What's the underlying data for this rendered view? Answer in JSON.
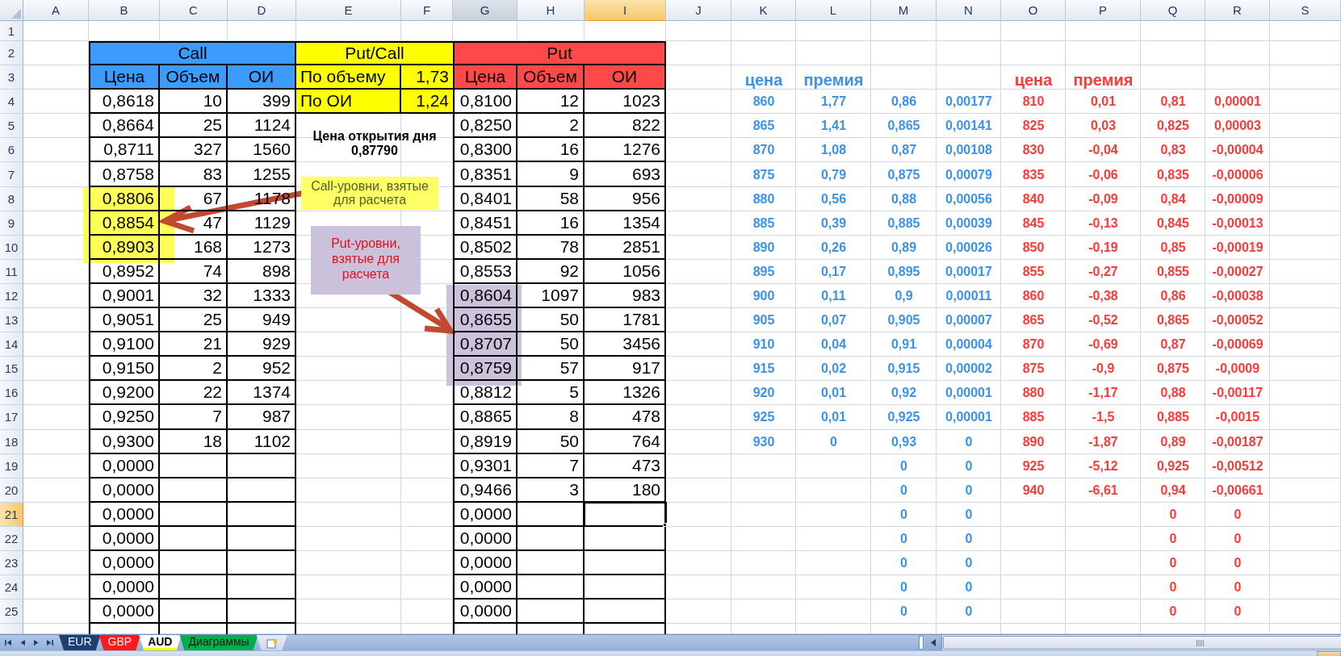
{
  "columns": [
    {
      "label": "A",
      "selected": false,
      "hovered": false
    },
    {
      "label": "B",
      "selected": false,
      "hovered": false
    },
    {
      "label": "C",
      "selected": false,
      "hovered": false
    },
    {
      "label": "D",
      "selected": false,
      "hovered": false
    },
    {
      "label": "E",
      "selected": false,
      "hovered": false
    },
    {
      "label": "F",
      "selected": false,
      "hovered": false
    },
    {
      "label": "G",
      "selected": false,
      "hovered": true
    },
    {
      "label": "H",
      "selected": false,
      "hovered": false
    },
    {
      "label": "I",
      "selected": true,
      "hovered": false
    },
    {
      "label": "J",
      "selected": false,
      "hovered": false
    },
    {
      "label": "K",
      "selected": false,
      "hovered": false
    },
    {
      "label": "L",
      "selected": false,
      "hovered": false
    },
    {
      "label": "M",
      "selected": false,
      "hovered": false
    },
    {
      "label": "N",
      "selected": false,
      "hovered": false
    },
    {
      "label": "O",
      "selected": false,
      "hovered": false
    },
    {
      "label": "P",
      "selected": false,
      "hovered": false
    },
    {
      "label": "Q",
      "selected": false,
      "hovered": false
    },
    {
      "label": "R",
      "selected": false,
      "hovered": false
    },
    {
      "label": "S",
      "selected": false,
      "hovered": false
    }
  ],
  "rows": [
    {
      "label": "1",
      "selected": false
    },
    {
      "label": "2",
      "selected": false
    },
    {
      "label": "3",
      "selected": false
    },
    {
      "label": "4",
      "selected": false
    },
    {
      "label": "5",
      "selected": false
    },
    {
      "label": "6",
      "selected": false
    },
    {
      "label": "7",
      "selected": false
    },
    {
      "label": "8",
      "selected": false
    },
    {
      "label": "9",
      "selected": false
    },
    {
      "label": "10",
      "selected": false
    },
    {
      "label": "11",
      "selected": false
    },
    {
      "label": "12",
      "selected": false
    },
    {
      "label": "13",
      "selected": false
    },
    {
      "label": "14",
      "selected": false
    },
    {
      "label": "15",
      "selected": false
    },
    {
      "label": "16",
      "selected": false
    },
    {
      "label": "17",
      "selected": false
    },
    {
      "label": "18",
      "selected": false
    },
    {
      "label": "19",
      "selected": false
    },
    {
      "label": "20",
      "selected": false
    },
    {
      "label": "21",
      "selected": true
    },
    {
      "label": "22",
      "selected": false
    },
    {
      "label": "23",
      "selected": false
    },
    {
      "label": "24",
      "selected": false
    },
    {
      "label": "25",
      "selected": false
    }
  ],
  "call_table": {
    "title": "Call",
    "headers": [
      "Цена",
      "Объем",
      "ОИ"
    ],
    "rows": [
      {
        "price": "0,8618",
        "volume": "10",
        "oi": "399",
        "highlighted": false
      },
      {
        "price": "0,8664",
        "volume": "25",
        "oi": "1124",
        "highlighted": false
      },
      {
        "price": "0,8711",
        "volume": "327",
        "oi": "1560",
        "highlighted": false
      },
      {
        "price": "0,8758",
        "volume": "83",
        "oi": "1255",
        "highlighted": false
      },
      {
        "price": "0,8806",
        "volume": "67",
        "oi": "1178",
        "highlighted": true
      },
      {
        "price": "0,8854",
        "volume": "47",
        "oi": "1129",
        "highlighted": true
      },
      {
        "price": "0,8903",
        "volume": "168",
        "oi": "1273",
        "highlighted": true
      },
      {
        "price": "0,8952",
        "volume": "74",
        "oi": "898",
        "highlighted": false
      },
      {
        "price": "0,9001",
        "volume": "32",
        "oi": "1333",
        "highlighted": false
      },
      {
        "price": "0,9051",
        "volume": "25",
        "oi": "949",
        "highlighted": false
      },
      {
        "price": "0,9100",
        "volume": "21",
        "oi": "929",
        "highlighted": false
      },
      {
        "price": "0,9150",
        "volume": "2",
        "oi": "952",
        "highlighted": false
      },
      {
        "price": "0,9200",
        "volume": "22",
        "oi": "1374",
        "highlighted": false
      },
      {
        "price": "0,9250",
        "volume": "7",
        "oi": "987",
        "highlighted": false
      },
      {
        "price": "0,9300",
        "volume": "18",
        "oi": "1102",
        "highlighted": false
      },
      {
        "price": "0,0000",
        "highlighted": false
      },
      {
        "price": "0,0000",
        "highlighted": false
      },
      {
        "price": "0,0000",
        "highlighted": false
      },
      {
        "price": "0,0000",
        "highlighted": false
      },
      {
        "price": "0,0000",
        "highlighted": false
      },
      {
        "price": "0,0000",
        "highlighted": false
      },
      {
        "price": "0,0000",
        "highlighted": false
      }
    ]
  },
  "put_call": {
    "title": "Put/Call",
    "rows": [
      {
        "label": "По объему",
        "value": "1,73"
      },
      {
        "label": "По ОИ",
        "value": "1,24"
      }
    ]
  },
  "open_price": {
    "label": "Цена открытия дня",
    "value": "0,87790"
  },
  "put_table": {
    "title": "Put",
    "headers": [
      "Цена",
      "Объем",
      "ОИ"
    ],
    "rows": [
      {
        "price": "0,8100",
        "volume": "12",
        "oi": "1023",
        "highlighted": false
      },
      {
        "price": "0,8250",
        "volume": "2",
        "oi": "822",
        "highlighted": false
      },
      {
        "price": "0,8300",
        "volume": "16",
        "oi": "1276",
        "highlighted": false
      },
      {
        "price": "0,8351",
        "volume": "9",
        "oi": "693",
        "highlighted": false
      },
      {
        "price": "0,8401",
        "volume": "58",
        "oi": "956",
        "highlighted": false
      },
      {
        "price": "0,8451",
        "volume": "16",
        "oi": "1354",
        "highlighted": false
      },
      {
        "price": "0,8502",
        "volume": "78",
        "oi": "2851",
        "highlighted": false
      },
      {
        "price": "0,8553",
        "volume": "92",
        "oi": "1056",
        "highlighted": false
      },
      {
        "price": "0,8604",
        "volume": "1097",
        "oi": "983",
        "highlighted": true
      },
      {
        "price": "0,8655",
        "volume": "50",
        "oi": "1781",
        "highlighted": true
      },
      {
        "price": "0,8707",
        "volume": "50",
        "oi": "3456",
        "highlighted": true
      },
      {
        "price": "0,8759",
        "volume": "57",
        "oi": "917",
        "highlighted": true
      },
      {
        "price": "0,8812",
        "volume": "5",
        "oi": "1326",
        "highlighted": false
      },
      {
        "price": "0,8865",
        "volume": "8",
        "oi": "478",
        "highlighted": false
      },
      {
        "price": "0,8919",
        "volume": "50",
        "oi": "764",
        "highlighted": false
      },
      {
        "price": "0,9301",
        "volume": "7",
        "oi": "473",
        "highlighted": false
      },
      {
        "price": "0,9466",
        "volume": "3",
        "oi": "180",
        "highlighted": false
      },
      {
        "price": "0,0000",
        "highlighted": false
      },
      {
        "price": "0,0000",
        "highlighted": false
      },
      {
        "price": "0,0000",
        "highlighted": false
      },
      {
        "price": "0,0000",
        "highlighted": false
      },
      {
        "price": "0,0000",
        "highlighted": false
      }
    ]
  },
  "callouts": [
    {
      "kind": "call",
      "text": "Call-уровни, взятые для расчета"
    },
    {
      "kind": "put",
      "text": "Put-уровни, взятые для расчета"
    }
  ],
  "call_calc": {
    "headers": [
      "цена",
      "премия"
    ],
    "rows": [
      {
        "price": "860",
        "premium": "1,77",
        "column_3": "0,86",
        "column_4": "0,00177"
      },
      {
        "price": "865",
        "premium": "1,41",
        "column_3": "0,865",
        "column_4": "0,00141"
      },
      {
        "price": "870",
        "premium": "1,08",
        "column_3": "0,87",
        "column_4": "0,00108"
      },
      {
        "price": "875",
        "premium": "0,79",
        "column_3": "0,875",
        "column_4": "0,00079"
      },
      {
        "price": "880",
        "premium": "0,56",
        "column_3": "0,88",
        "column_4": "0,00056"
      },
      {
        "price": "885",
        "premium": "0,39",
        "column_3": "0,885",
        "column_4": "0,00039"
      },
      {
        "price": "890",
        "premium": "0,26",
        "column_3": "0,89",
        "column_4": "0,00026"
      },
      {
        "price": "895",
        "premium": "0,17",
        "column_3": "0,895",
        "column_4": "0,00017"
      },
      {
        "price": "900",
        "premium": "0,11",
        "column_3": "0,9",
        "column_4": "0,00011"
      },
      {
        "price": "905",
        "premium": "0,07",
        "column_3": "0,905",
        "column_4": "0,00007"
      },
      {
        "price": "910",
        "premium": "0,04",
        "column_3": "0,91",
        "column_4": "0,00004"
      },
      {
        "price": "915",
        "premium": "0,02",
        "column_3": "0,915",
        "column_4": "0,00002"
      },
      {
        "price": "920",
        "premium": "0,01",
        "column_3": "0,92",
        "column_4": "0,00001"
      },
      {
        "price": "925",
        "premium": "0,01",
        "column_3": "0,925",
        "column_4": "0,00001"
      },
      {
        "price": "930",
        "premium": "0",
        "column_3": "0,93",
        "column_4": "0"
      },
      {
        "column_3": "0",
        "column_4": "0"
      },
      {
        "column_3": "0",
        "column_4": "0"
      },
      {
        "column_3": "0",
        "column_4": "0"
      },
      {
        "column_3": "0",
        "column_4": "0"
      },
      {
        "column_3": "0",
        "column_4": "0"
      },
      {
        "column_3": "0",
        "column_4": "0"
      },
      {
        "column_3": "0",
        "column_4": "0"
      }
    ]
  },
  "put_calc": {
    "headers": [
      "цена",
      "премия"
    ],
    "rows": [
      {
        "price": "810",
        "premium": "0,01",
        "column_3": "0,81",
        "column_4": "0,00001"
      },
      {
        "price": "825",
        "premium": "0,03",
        "column_3": "0,825",
        "column_4": "0,00003"
      },
      {
        "price": "830",
        "premium": "-0,04",
        "column_3": "0,83",
        "column_4": "-0,00004"
      },
      {
        "price": "835",
        "premium": "-0,06",
        "column_3": "0,835",
        "column_4": "-0,00006"
      },
      {
        "price": "840",
        "premium": "-0,09",
        "column_3": "0,84",
        "column_4": "-0,00009"
      },
      {
        "price": "845",
        "premium": "-0,13",
        "column_3": "0,845",
        "column_4": "-0,00013"
      },
      {
        "price": "850",
        "premium": "-0,19",
        "column_3": "0,85",
        "column_4": "-0,00019"
      },
      {
        "price": "855",
        "premium": "-0,27",
        "column_3": "0,855",
        "column_4": "-0,00027"
      },
      {
        "price": "860",
        "premium": "-0,38",
        "column_3": "0,86",
        "column_4": "-0,00038"
      },
      {
        "price": "865",
        "premium": "-0,52",
        "column_3": "0,865",
        "column_4": "-0,00052"
      },
      {
        "price": "870",
        "premium": "-0,69",
        "column_3": "0,87",
        "column_4": "-0,00069"
      },
      {
        "price": "875",
        "premium": "-0,9",
        "column_3": "0,875",
        "column_4": "-0,0009"
      },
      {
        "price": "880",
        "premium": "-1,17",
        "column_3": "0,88",
        "column_4": "-0,00117"
      },
      {
        "price": "885",
        "premium": "-1,5",
        "column_3": "0,885",
        "column_4": "-0,0015"
      },
      {
        "price": "890",
        "premium": "-1,87",
        "column_3": "0,89",
        "column_4": "-0,00187"
      },
      {
        "price": "925",
        "premium": "-5,12",
        "column_3": "0,925",
        "column_4": "-0,00512"
      },
      {
        "price": "940",
        "premium": "-6,61",
        "column_3": "0,94",
        "column_4": "-0,00661"
      },
      {
        "column_3": "0",
        "column_4": "0"
      },
      {
        "column_3": "0",
        "column_4": "0"
      },
      {
        "column_3": "0",
        "column_4": "0"
      },
      {
        "column_3": "0",
        "column_4": "0"
      },
      {
        "column_3": "0",
        "column_4": "0"
      }
    ]
  },
  "sheet_tabs": [
    {
      "label": "EUR",
      "selected": false,
      "color": "#1f3f73"
    },
    {
      "label": "GBP",
      "selected": false,
      "color": "#ff1a1a"
    },
    {
      "label": "AUD",
      "selected": true,
      "color": "#ffff00"
    },
    {
      "label": "Диаграммы",
      "selected": false,
      "color": "#00b050"
    }
  ]
}
